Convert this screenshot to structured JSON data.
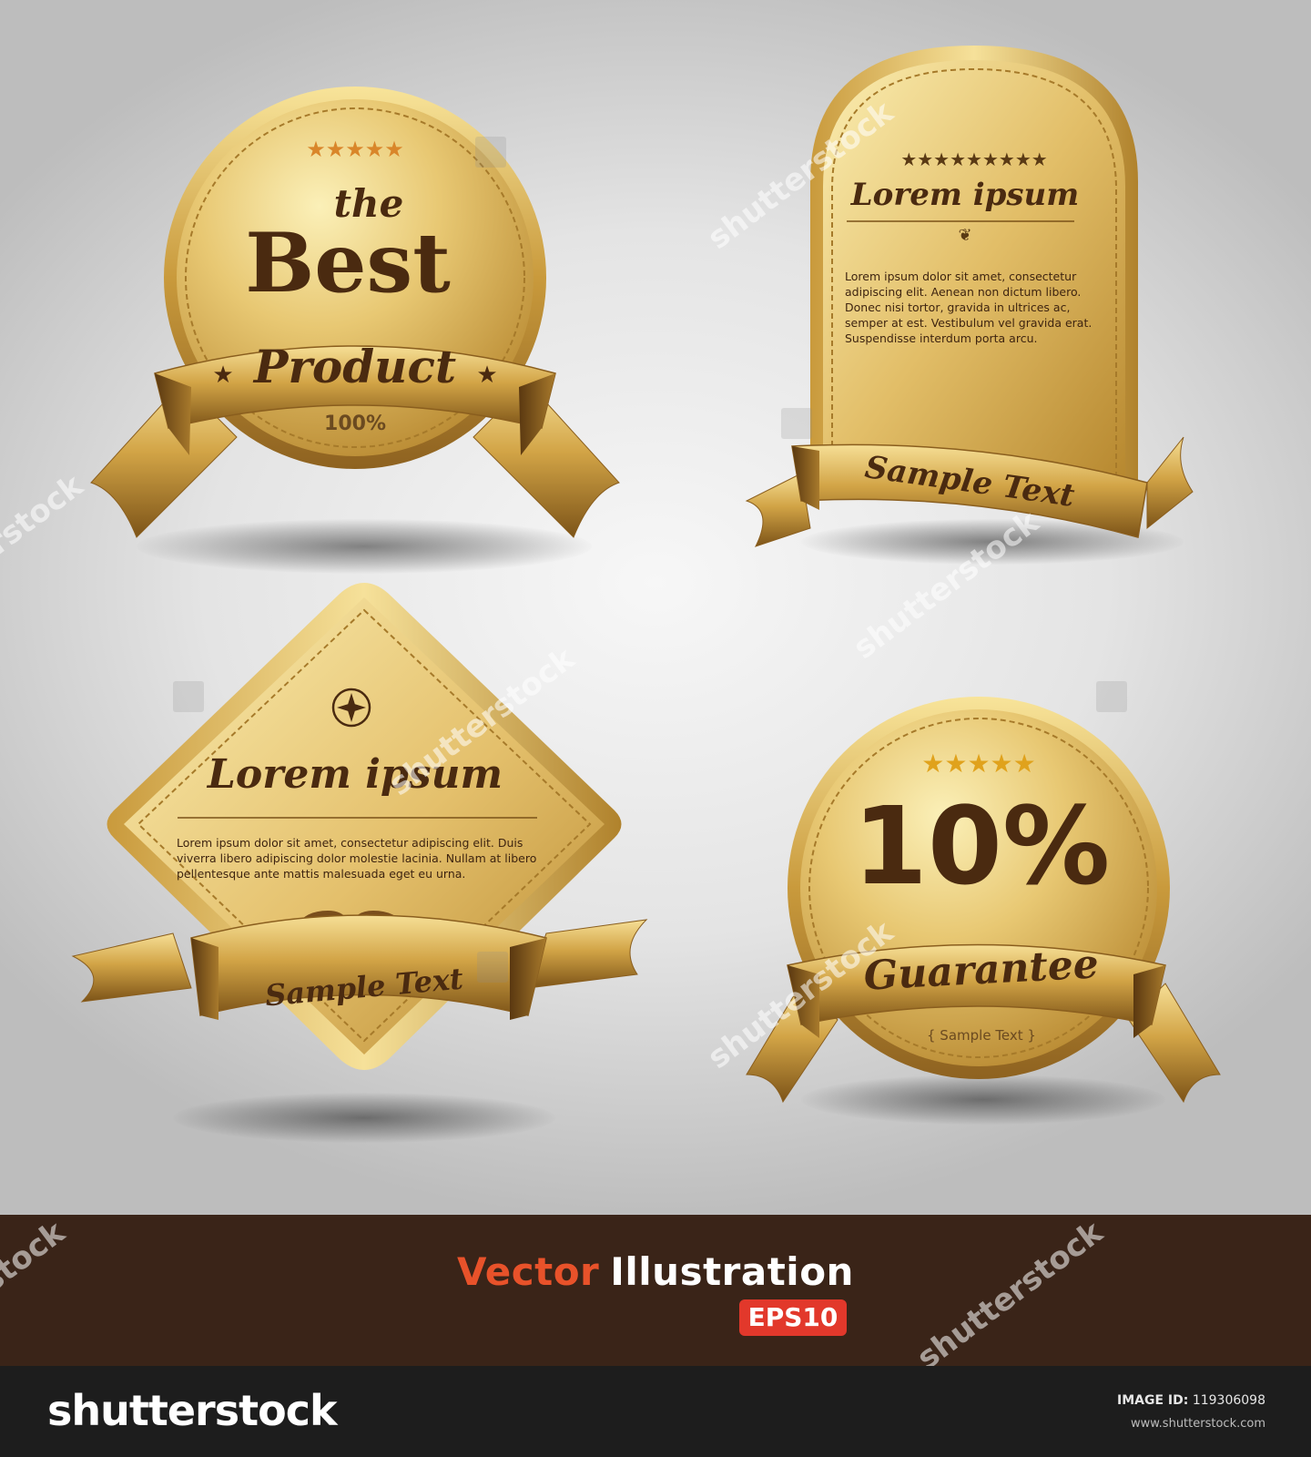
{
  "colors": {
    "gold_light": "#f4dc8c",
    "gold_mid": "#d7ae4e",
    "gold_dark": "#9a6d22",
    "brown_text": "#4a2a10",
    "footer_band": "#3a2418",
    "accent_orange": "#e8522a",
    "eps_red": "#e2382b"
  },
  "badge_best": {
    "stars": "★★★★★",
    "line1": "the",
    "line2": "Best",
    "ribbon": "Product",
    "percent": "100%"
  },
  "badge_arch": {
    "stars": "★★★★★★★★★",
    "title": "Lorem ipsum",
    "body_lines": [
      "Lorem ipsum dolor sit amet, consectetur",
      "adipiscing elit. Aenean non dictum libero.",
      "Donec nisi tortor, gravida in ultrices ac,",
      "semper at est. Vestibulum vel gravida erat.",
      "Suspendisse interdum porta arcu."
    ],
    "ribbon": "Sample Text"
  },
  "badge_diamond": {
    "title": "Lorem ipsum",
    "body_lines": [
      "Lorem ipsum dolor sit amet, consectetur adipiscing elit. Duis",
      "viverra libero adipiscing dolor molestie lacinia. Nullam at libero",
      "pellentesque ante mattis malesuada eget eu urna."
    ],
    "ribbon": "Sample Text"
  },
  "badge_guarantee": {
    "stars": "★★★★★",
    "big": "10%",
    "ribbon": "Guarantee",
    "caption": "{ Sample Text }"
  },
  "footer": {
    "title_word1": "Vector",
    "title_word2": "Illustration",
    "badge": "EPS10"
  },
  "bottom_bar": {
    "brand": "shutterstock",
    "image_id_label": "IMAGE ID:",
    "image_id_value": "119306098",
    "site": "www.shutterstock.com"
  },
  "watermark_text": "shutterstock"
}
